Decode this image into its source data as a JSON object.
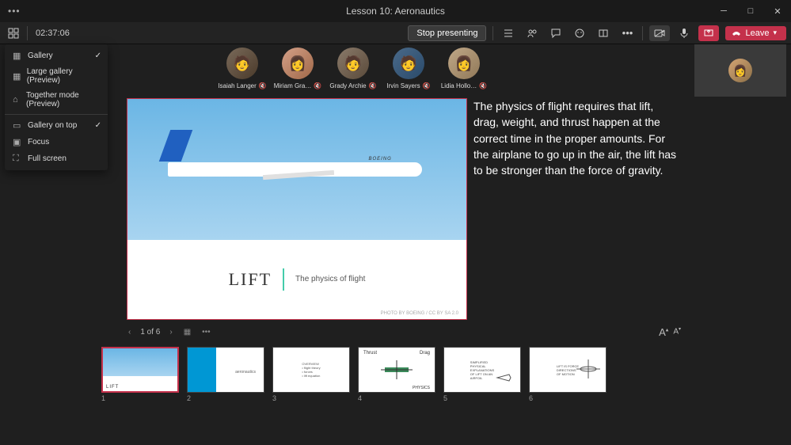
{
  "window": {
    "title": "Lesson 10: Aeronautics"
  },
  "toolbar": {
    "timer": "02:37:06",
    "stop_presenting": "Stop presenting",
    "leave": "Leave"
  },
  "view_menu": {
    "items": [
      {
        "label": "Gallery",
        "checked": true
      },
      {
        "label": "Large gallery (Preview)",
        "checked": false
      },
      {
        "label": "Together mode (Preview)",
        "checked": false
      }
    ],
    "items2": [
      {
        "label": "Gallery on top",
        "checked": true
      },
      {
        "label": "Focus",
        "checked": false
      },
      {
        "label": "Full screen",
        "checked": false
      }
    ]
  },
  "participants": [
    {
      "name": "Isaiah Langer",
      "avatar_bg": "linear-gradient(135deg,#555,#333)"
    },
    {
      "name": "Miriam Gra…",
      "avatar_bg": "linear-gradient(135deg,#c97,#a65)"
    },
    {
      "name": "Grady Archie",
      "avatar_bg": "linear-gradient(135deg,#876,#543)"
    },
    {
      "name": "Irvin Sayers",
      "avatar_bg": "linear-gradient(135deg,#368,#135)"
    },
    {
      "name": "Lidia Hollo…",
      "avatar_bg": "linear-gradient(135deg,#ba8,#875)"
    }
  ],
  "notes": {
    "text": "The physics of flight requires that lift, drag, weight, and thrust happen at the correct time in the proper amounts. For the airplane to go up in the air, the lift has to be stronger than the force of gravity."
  },
  "slide": {
    "brand": "BOEING",
    "title": "LIFT",
    "subtitle": "The physics of flight",
    "credit": "PHOTO BY BOEING / CC BY SA 2.0"
  },
  "slide_nav": {
    "position": "1 of 6",
    "font_large": "Aᵃ",
    "font_small": "Aᵃ"
  },
  "thumbnails": [
    {
      "num": "1",
      "active": true
    },
    {
      "num": "2",
      "active": false
    },
    {
      "num": "3",
      "active": false
    },
    {
      "num": "4",
      "active": false
    },
    {
      "num": "5",
      "active": false
    },
    {
      "num": "6",
      "active": false
    }
  ]
}
